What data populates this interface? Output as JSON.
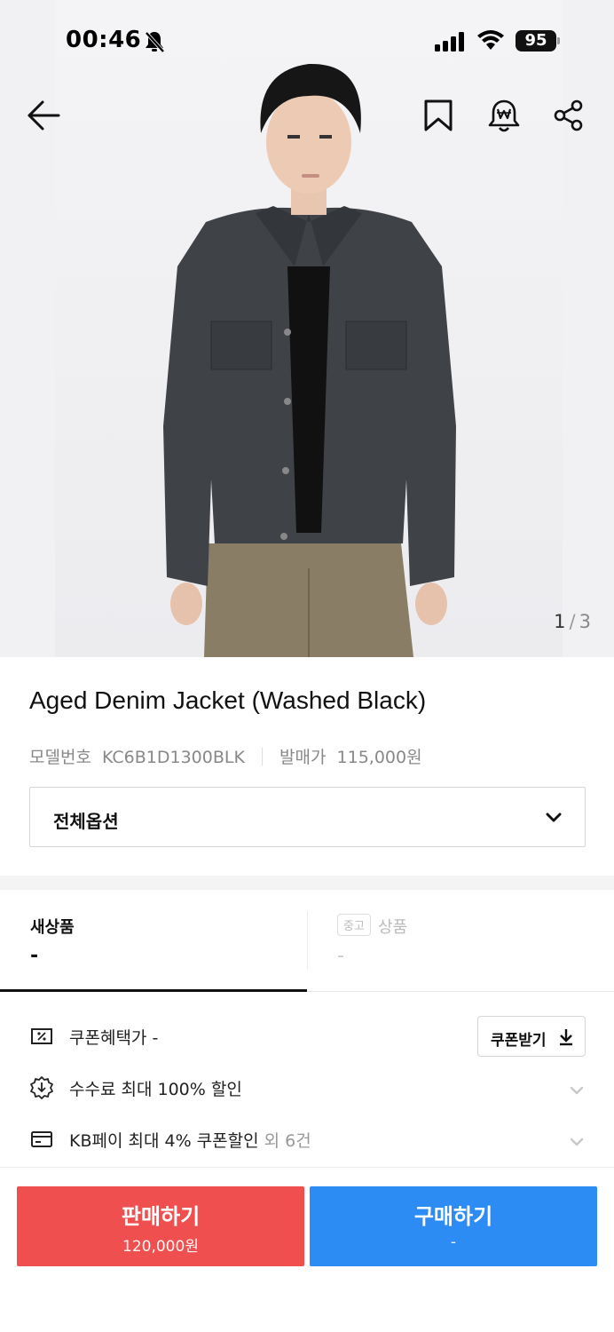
{
  "status_bar": {
    "time": "00:46",
    "battery": "95"
  },
  "gallery": {
    "current": "1",
    "separator": "/",
    "total": "3"
  },
  "product": {
    "title": "Aged Denim Jacket (Washed Black)",
    "model_label": "모델번호",
    "model_value": "KC6B1D1300BLK",
    "release_label": "발매가",
    "release_value": "115,000원",
    "option_label": "전체옵션"
  },
  "tabs": {
    "new_label": "새상품",
    "new_value": "-",
    "used_chip": "중고",
    "used_label": "상품",
    "used_value": "-"
  },
  "benefits": {
    "coupon_price_label": "쿠폰혜택가 -",
    "coupon_button": "쿠폰받기",
    "fee_discount": "수수료 최대 100% 할인",
    "kbpay_main": "KB페이 최대 4% 쿠폰할인",
    "kbpay_more": " 외 6건"
  },
  "actions": {
    "sell_label": "판매하기",
    "sell_price": "120,000원",
    "buy_label": "구매하기",
    "buy_price": "-"
  },
  "colors": {
    "sell": "#ef4f4f",
    "buy": "#2c8cf4"
  },
  "icons": [
    "back-arrow-icon",
    "bookmark-icon",
    "price-alert-icon",
    "share-icon",
    "chevron-down-icon",
    "coupon-icon",
    "fee-discount-icon",
    "card-icon",
    "download-icon"
  ]
}
